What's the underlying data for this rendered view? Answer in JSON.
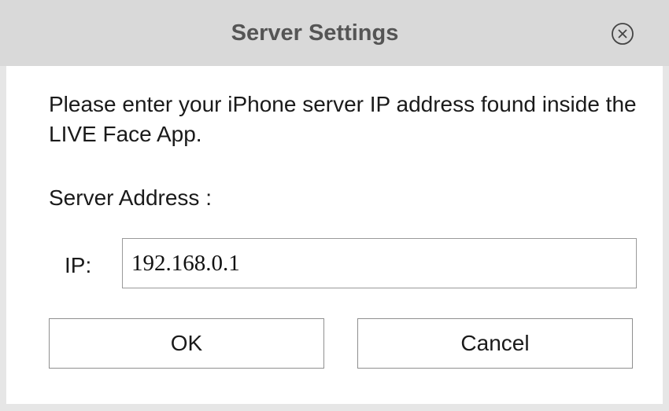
{
  "window": {
    "title": "Server Settings",
    "close_icon": "close-circle-icon"
  },
  "body": {
    "message": "Please enter your iPhone server IP address found inside the LIVE Face App.",
    "section_label": "Server Address :",
    "ip_label": "IP:",
    "ip_value": "192.168.0.1"
  },
  "buttons": {
    "ok_label": "OK",
    "cancel_label": "Cancel"
  },
  "colors": {
    "titlebar": "#d9d9d9",
    "frame": "#e6e6e6",
    "content": "#ffffff",
    "title_text": "#555555"
  }
}
